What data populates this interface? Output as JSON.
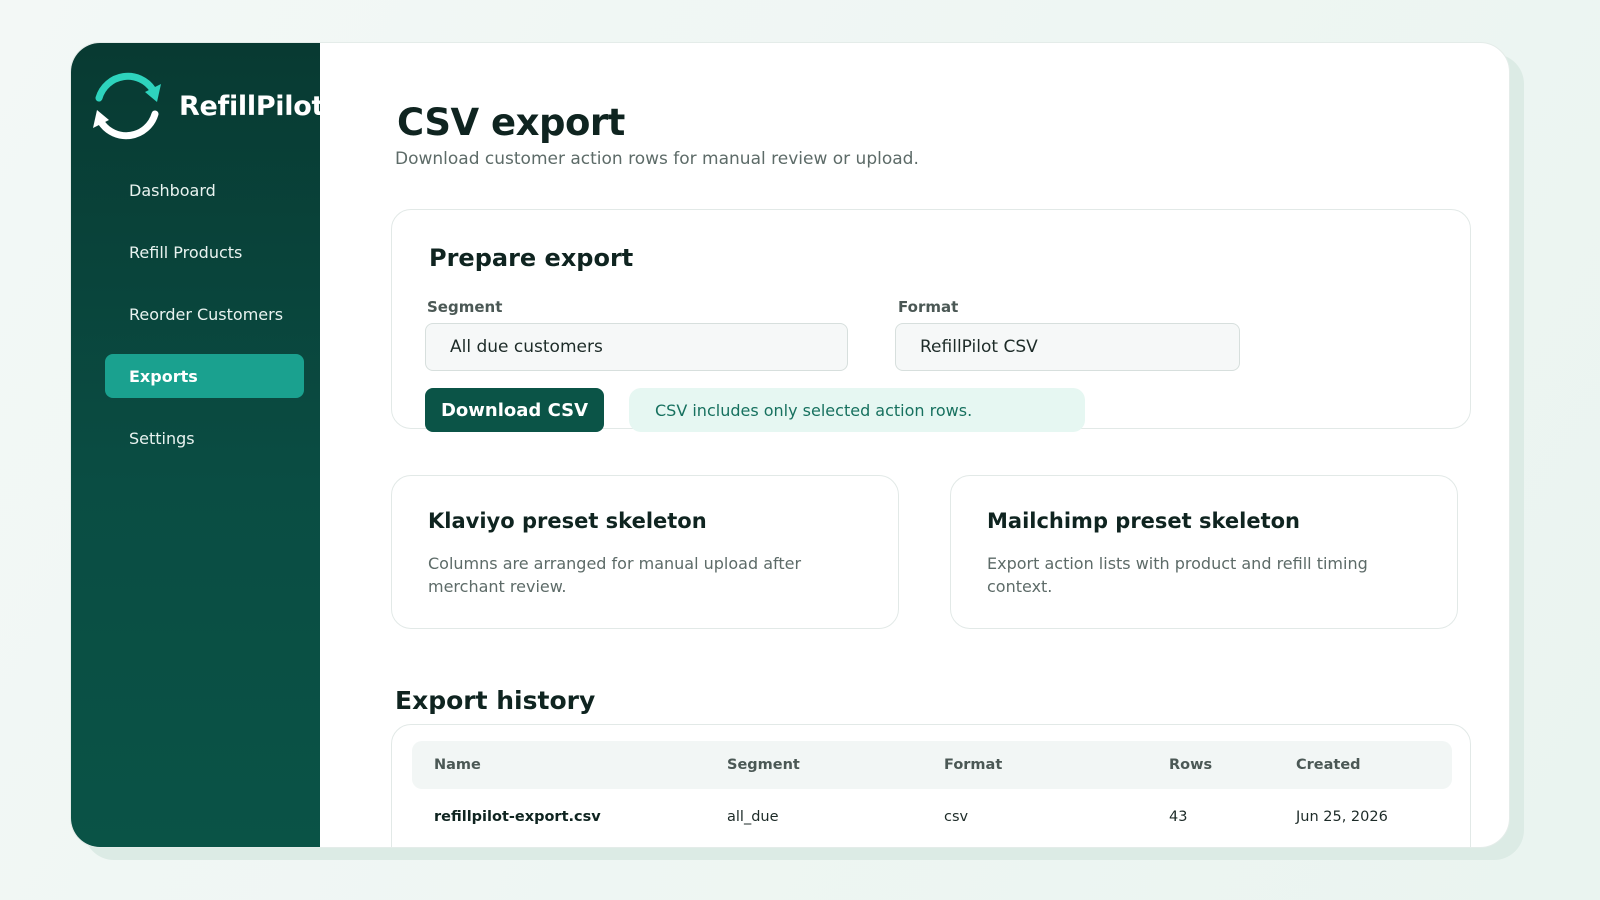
{
  "app": {
    "name": "RefillPilot"
  },
  "colors": {
    "sidebar": "#083a32",
    "accent": "#1aa18f",
    "primary_button": "#0b5447",
    "note_bg": "#e6f7f2"
  },
  "sidebar": {
    "items": [
      {
        "label": "Dashboard",
        "active": false
      },
      {
        "label": "Refill Products",
        "active": false
      },
      {
        "label": "Reorder Customers",
        "active": false
      },
      {
        "label": "Exports",
        "active": true
      },
      {
        "label": "Settings",
        "active": false
      }
    ]
  },
  "page": {
    "title": "CSV export",
    "subtitle": "Download customer action rows for manual review or upload."
  },
  "prepare": {
    "title": "Prepare export",
    "segment_label": "Segment",
    "segment_value": "All due customers",
    "format_label": "Format",
    "format_value": "RefillPilot CSV",
    "download_label": "Download CSV",
    "note": "CSV includes only selected action rows."
  },
  "presets": [
    {
      "title": "Klaviyo preset skeleton",
      "description": "Columns are arranged for manual upload after merchant review."
    },
    {
      "title": "Mailchimp preset skeleton",
      "description": "Export action lists with product and refill timing context."
    }
  ],
  "history": {
    "title": "Export history",
    "columns": [
      "Name",
      "Segment",
      "Format",
      "Rows",
      "Created"
    ],
    "rows": [
      [
        "refillpilot-export.csv",
        "all_due",
        "csv",
        "43",
        "Jun 25, 2026"
      ]
    ]
  }
}
